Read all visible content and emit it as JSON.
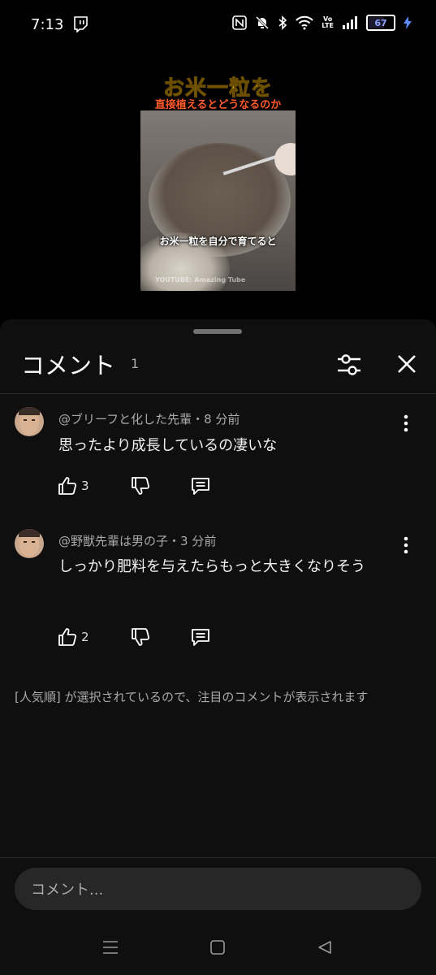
{
  "status_bar": {
    "time": "7:13",
    "volte_label": "Vo\nLTE",
    "battery": "67",
    "battery_level": 0.67
  },
  "video": {
    "title_line1": "お米一粒を",
    "title_line2": "直接植えるとどうなるのか",
    "subtitle": "お米一粒を自分で育てると",
    "watermark": "YOUTUBE: Amazing Tube"
  },
  "comments_panel": {
    "title": "コメント",
    "count": "1",
    "comments": [
      {
        "author_time": "@ブリーフと化した先輩・8 分前",
        "text": "思ったより成長しているの凄いな",
        "likes": "3"
      },
      {
        "author_time": "@野獣先輩は男の子・3 分前",
        "text": "しっかり肥料を与えたらもっと大きくなりそう",
        "likes": "2"
      }
    ],
    "notice": "[人気順] が選択されているので、注目のコメントが表示されます",
    "compose_placeholder": "コメント..."
  },
  "colors": {
    "sheet_bg": "#0f0f0f",
    "title_yellow": "#e7c41f",
    "title_red": "#ff5a2a",
    "battery_text": "#8da2ff"
  }
}
